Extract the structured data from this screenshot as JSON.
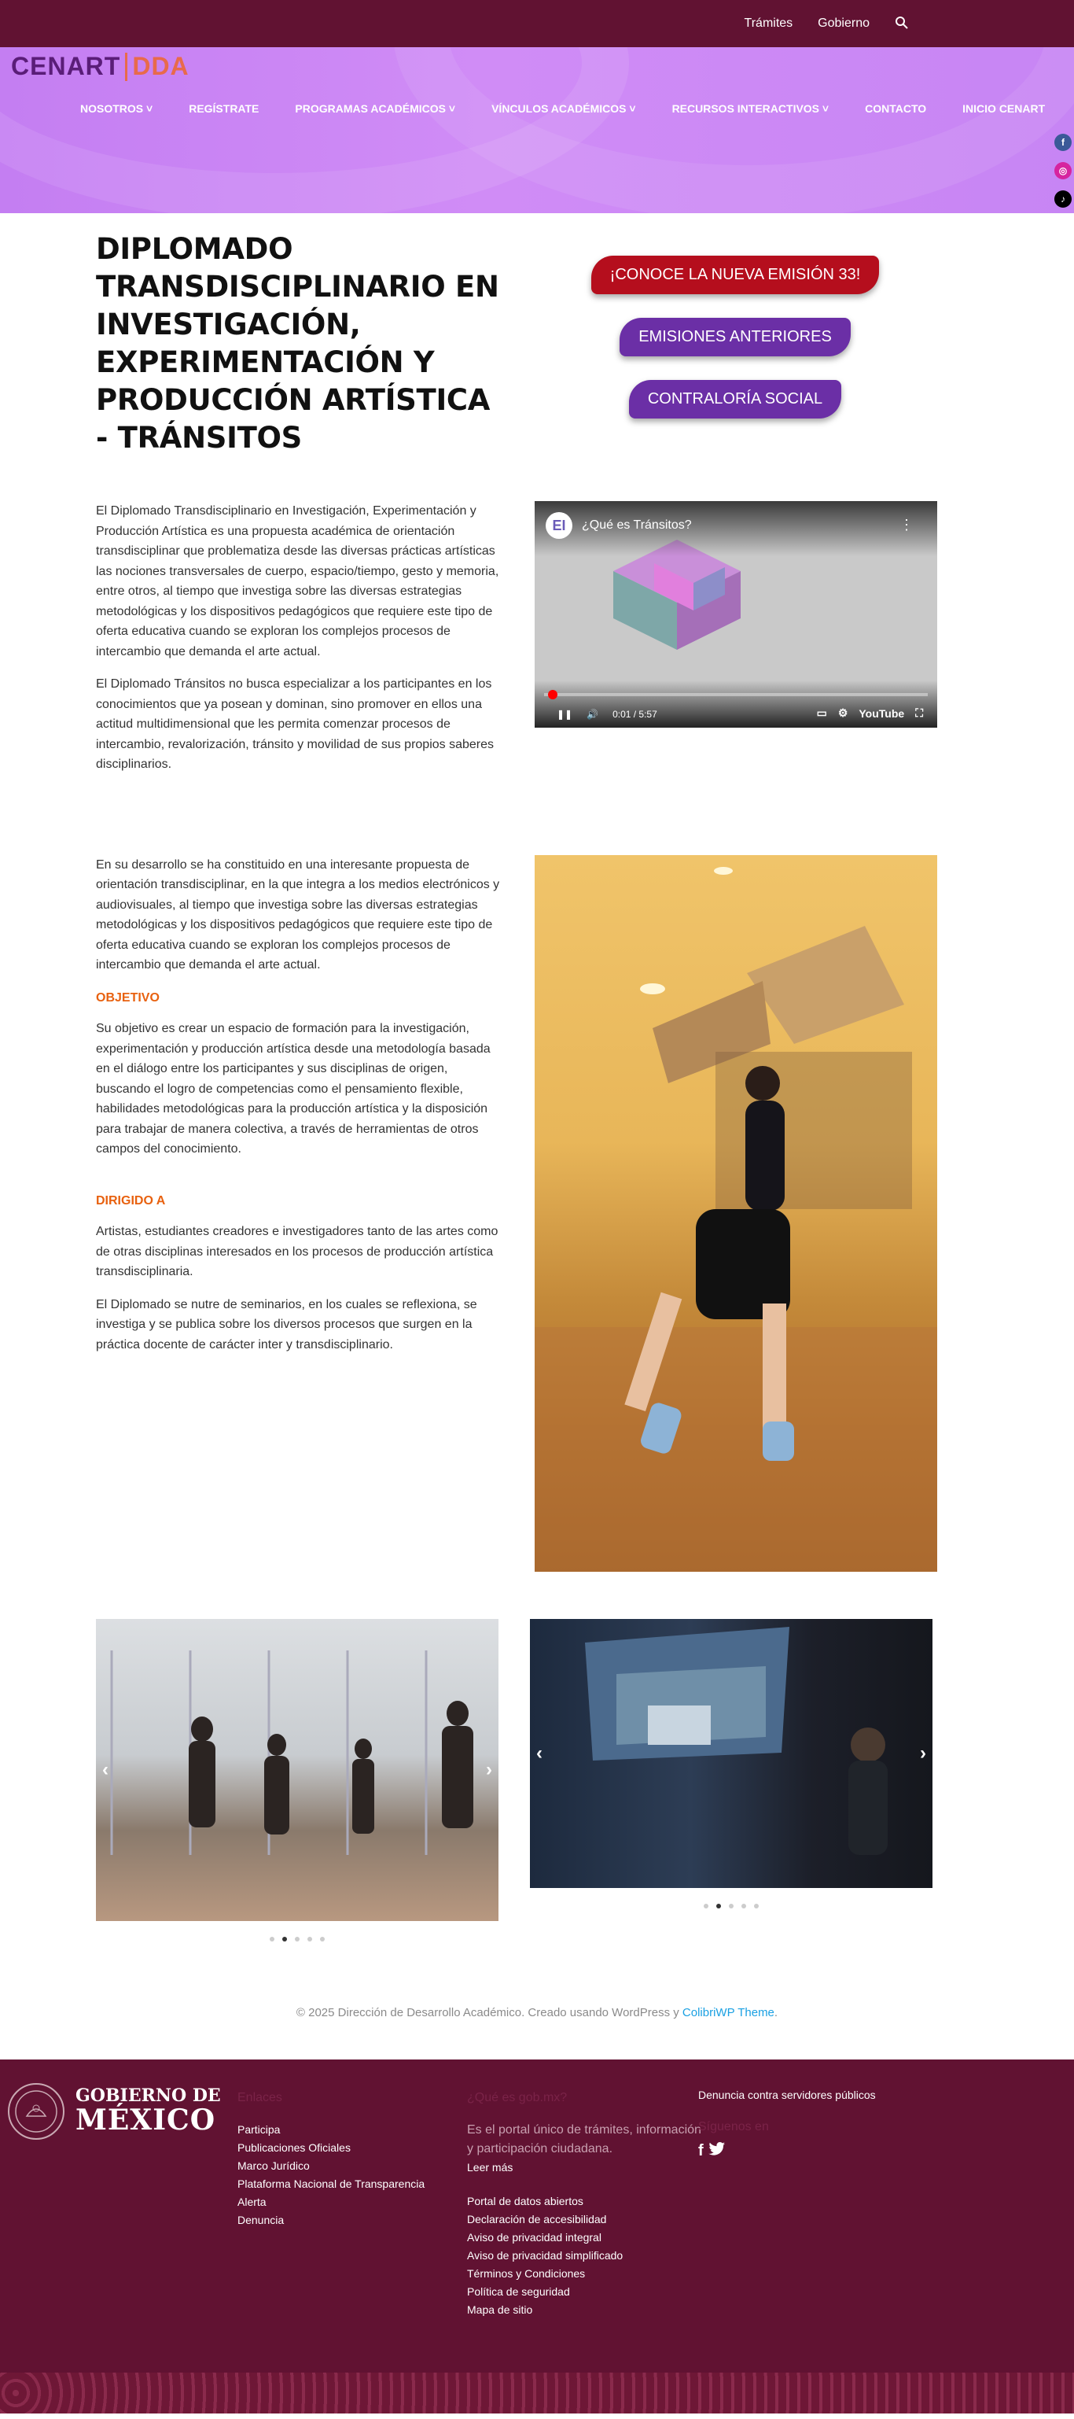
{
  "topbar": {
    "links": [
      "Trámites",
      "Gobierno"
    ],
    "search_icon": "search-icon"
  },
  "logo": {
    "part1": "CENART",
    "part2": "DDA"
  },
  "nav": {
    "items": [
      "NOSOTROS",
      "REGÍSTRATE",
      "PROGRAMAS ACADÉMICOS",
      "VÍNCULOS ACADÉMICOS",
      "RECURSOS INTERACTIVOS",
      "CONTACTO",
      "INICIO CENART"
    ],
    "dropdown": [
      true,
      false,
      true,
      true,
      true,
      false,
      false
    ]
  },
  "social": [
    "facebook-icon",
    "instagram-icon",
    "tiktok-icon",
    "x-icon",
    "youtube-icon"
  ],
  "page": {
    "title": "DIPLOMADO TRANSDISCIPLINARIO EN INVESTIGACIÓN, EXPERIMENTACIÓN Y PRODUCCIÓN ARTÍSTICA - TRÁNSITOS",
    "buttons": [
      "¡CONOCE LA NUEVA EMISIÓN 33!",
      "EMISIONES ANTERIORES",
      "CONTRALORÍA SOCIAL"
    ]
  },
  "intro": {
    "p1": "El Diplomado Transdisciplinario en Investigación, Experimentación y Producción Artística es una propuesta académica de orientación transdisciplinar que problematiza desde las diversas prácticas artísticas las nociones transversales de cuerpo, espacio/tiempo, gesto y memoria, entre otros, al tiempo que investiga sobre las diversas estrategias metodológicas y los dispositivos pedagógicos que requiere este tipo de oferta educativa cuando se exploran los complejos procesos de intercambio que demanda el arte actual.",
    "p2": "El Diplomado Tránsitos no busca especializar a los participantes en los conocimientos que ya posean y dominan, sino promover en ellos una actitud multidimensional que les permita comenzar procesos de intercambio, revalorización, tránsito y movilidad de sus propios saberes disciplinarios."
  },
  "video": {
    "badge": "EI",
    "title": "¿Qué es Tránsitos?",
    "time": "0:01 / 5:57",
    "brand": "YouTube",
    "progress": 0.01
  },
  "details": {
    "p1": "En su desarrollo se ha constituido en una interesante propuesta de orientación transdisciplinar, en la que integra a los medios electrónicos y audiovisuales, al tiempo que investiga sobre las diversas estrategias metodológicas y los dispositivos pedagógicos que requiere este tipo de oferta educativa cuando se exploran los complejos procesos de intercambio que demanda el arte actual.",
    "h_objetivo": "OBJETIVO",
    "objetivo": "Su objetivo es crear un espacio de formación para la investigación, experimentación y producción artística desde una metodología basada en el diálogo entre los participantes y sus disciplinas de origen, buscando el logro de competencias como el pensamiento flexible, habilidades metodológicas para la producción artística y la disposición para trabajar de manera colectiva, a través de herramientas de otros campos del conocimiento.",
    "h_dirigido": "DIRIGIDO A",
    "dirigido": "Artistas, estudiantes creadores e investigadores tanto de las artes como de otras disciplinas interesados en los procesos de producción artística transdisciplinaria.",
    "p_final": "El Diplomado se nutre de seminarios, en los cuales se reflexiona, se investiga y se publica sobre los diversos procesos que surgen en la práctica docente de carácter inter y transdisciplinario."
  },
  "carousels": [
    {
      "active": 1,
      "count": 5
    },
    {
      "active": 1,
      "count": 5
    }
  ],
  "credit": {
    "text": "© 2025 Dirección de Desarrollo Académico. Creado usando WordPress y ",
    "link": "ColibriWP Theme",
    "end": "."
  },
  "footer": {
    "gob_line1": "GOBIERNO DE",
    "gob_line2": "MÉXICO",
    "col1_title": "Enlaces",
    "col1": [
      "Participa",
      "Publicaciones Oficiales",
      "Marco Jurídico",
      "Plataforma Nacional de Transparencia",
      "Alerta",
      "Denuncia"
    ],
    "col2_title": "¿Qué es gob.mx?",
    "col2_text": "Es el portal único de trámites, información y participación ciudadana.",
    "col2_more": "Leer más",
    "col2_links": [
      "Portal de datos abiertos",
      "Declaración de accesibilidad",
      "Aviso de privacidad integral",
      "Aviso de privacidad simplificado",
      "Términos y Condiciones",
      "Política de seguridad",
      "Mapa de sitio"
    ],
    "col3_link": "Denuncia contra servidores públicos",
    "col3_title": "Síguenos en"
  }
}
